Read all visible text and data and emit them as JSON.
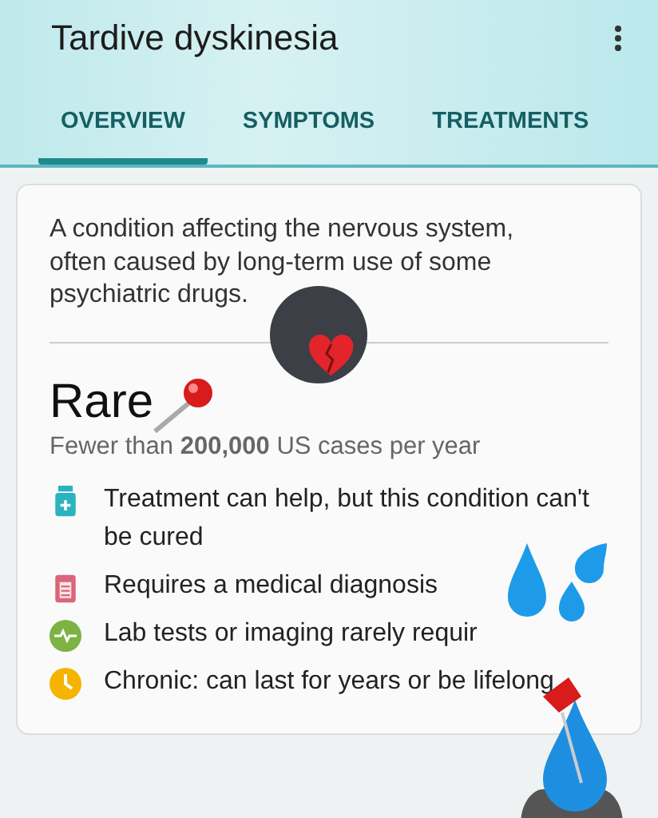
{
  "app_bar": {
    "title": "Tardive dyskinesia"
  },
  "tabs": [
    {
      "label": "OVERVIEW",
      "selected": true
    },
    {
      "label": "SYMPTOMS",
      "selected": false
    },
    {
      "label": "TREATMENTS",
      "selected": false
    }
  ],
  "card": {
    "description": "A condition affecting the nervous system, often caused by long-term use of some psychiatric drugs.",
    "prevalence": {
      "heading": "Rare",
      "detail": "Fewer than **200,000** US cases per year"
    },
    "facts": [
      {
        "kind": "treatment",
        "text": "Treatment can help, but this condition can't be cured"
      },
      {
        "kind": "diagnosis",
        "text": "Requires a medical diagnosis"
      },
      {
        "kind": "tests",
        "text": "Lab tests or imaging rarely requir"
      },
      {
        "kind": "duration",
        "text": "Chronic: can last for years or be lifelong"
      }
    ]
  }
}
